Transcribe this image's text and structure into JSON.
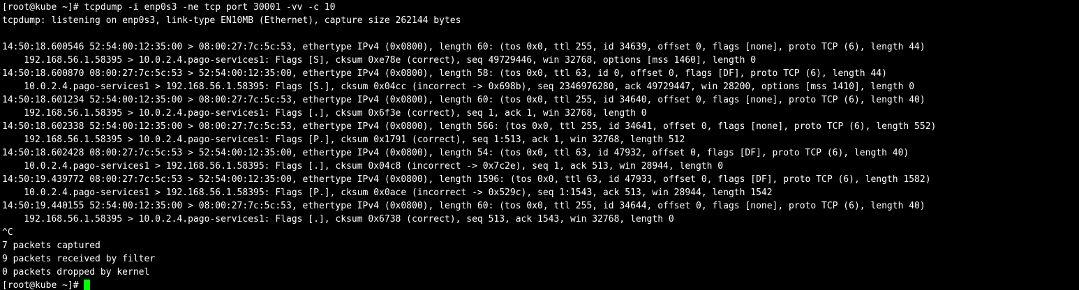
{
  "terminal": {
    "prompt": "[root@kube ~]# ",
    "command": "tcpdump -i enp0s3 -ne tcp port 30001 -vv -c 10",
    "cursor_color": "#00ff00",
    "lines": [
      "[root@kube ~]# tcpdump -i enp0s3 -ne tcp port 30001 -vv -c 10",
      "tcpdump: listening on enp0s3, link-type EN10MB (Ethernet), capture size 262144 bytes",
      "",
      "14:50:18.600546 52:54:00:12:35:00 > 08:00:27:7c:5c:53, ethertype IPv4 (0x0800), length 60: (tos 0x0, ttl 255, id 34639, offset 0, flags [none], proto TCP (6), length 44)",
      "    192.168.56.1.58395 > 10.0.2.4.pago-services1: Flags [S], cksum 0xe78e (correct), seq 49729446, win 32768, options [mss 1460], length 0",
      "14:50:18.600870 08:00:27:7c:5c:53 > 52:54:00:12:35:00, ethertype IPv4 (0x0800), length 58: (tos 0x0, ttl 63, id 0, offset 0, flags [DF], proto TCP (6), length 44)",
      "    10.0.2.4.pago-services1 > 192.168.56.1.58395: Flags [S.], cksum 0x04cc (incorrect -> 0x698b), seq 2346976280, ack 49729447, win 28200, options [mss 1410], length 0",
      "14:50:18.601234 52:54:00:12:35:00 > 08:00:27:7c:5c:53, ethertype IPv4 (0x0800), length 60: (tos 0x0, ttl 255, id 34640, offset 0, flags [none], proto TCP (6), length 40)",
      "    192.168.56.1.58395 > 10.0.2.4.pago-services1: Flags [.], cksum 0x6f3e (correct), seq 1, ack 1, win 32768, length 0",
      "14:50:18.602338 52:54:00:12:35:00 > 08:00:27:7c:5c:53, ethertype IPv4 (0x0800), length 566: (tos 0x0, ttl 255, id 34641, offset 0, flags [none], proto TCP (6), length 552)",
      "    192.168.56.1.58395 > 10.0.2.4.pago-services1: Flags [P.], cksum 0x1791 (correct), seq 1:513, ack 1, win 32768, length 512",
      "14:50:18.602428 08:00:27:7c:5c:53 > 52:54:00:12:35:00, ethertype IPv4 (0x0800), length 54: (tos 0x0, ttl 63, id 47932, offset 0, flags [DF], proto TCP (6), length 40)",
      "    10.0.2.4.pago-services1 > 192.168.56.1.58395: Flags [.], cksum 0x04c8 (incorrect -> 0x7c2e), seq 1, ack 513, win 28944, length 0",
      "14:50:19.439772 08:00:27:7c:5c:53 > 52:54:00:12:35:00, ethertype IPv4 (0x0800), length 1596: (tos 0x0, ttl 63, id 47933, offset 0, flags [DF], proto TCP (6), length 1582)",
      "    10.0.2.4.pago-services1 > 192.168.56.1.58395: Flags [P.], cksum 0x0ace (incorrect -> 0x529c), seq 1:1543, ack 513, win 28944, length 1542",
      "14:50:19.440155 52:54:00:12:35:00 > 08:00:27:7c:5c:53, ethertype IPv4 (0x0800), length 60: (tos 0x0, ttl 255, id 34644, offset 0, flags [none], proto TCP (6), length 40)",
      "    192.168.56.1.58395 > 10.0.2.4.pago-services1: Flags [.], cksum 0x6738 (correct), seq 513, ack 1543, win 32768, length 0",
      "^C",
      "7 packets captured",
      "9 packets received by filter",
      "0 packets dropped by kernel"
    ],
    "final_prompt": "[root@kube ~]# "
  }
}
